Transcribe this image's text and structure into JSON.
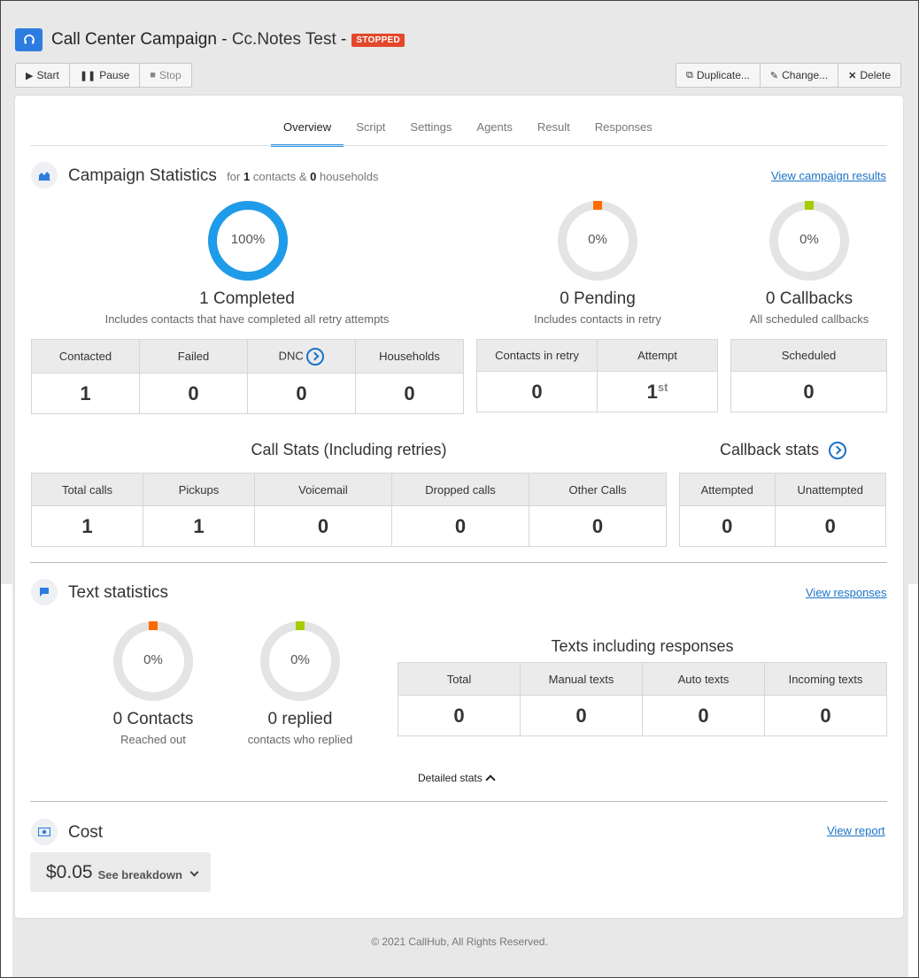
{
  "header": {
    "title": "Call Center Campaign",
    "separator": " - ",
    "subtitle": "Cc.Notes Test",
    "separator2": " - ",
    "status_badge": "STOPPED"
  },
  "toolbar": {
    "start_label": "Start",
    "pause_label": "Pause",
    "stop_label": "Stop",
    "duplicate_label": "Duplicate...",
    "change_label": "Change...",
    "delete_label": "Delete"
  },
  "tabs": [
    {
      "label": "Overview",
      "active": true
    },
    {
      "label": "Script"
    },
    {
      "label": "Settings"
    },
    {
      "label": "Agents"
    },
    {
      "label": "Result"
    },
    {
      "label": "Responses"
    }
  ],
  "campaign_stats": {
    "title": "Campaign Statistics",
    "meta_for": "for",
    "contacts_count": "1",
    "meta_contacts": "contacts &",
    "households_count": "0",
    "meta_households": "households",
    "view_link": "View campaign results",
    "completed": {
      "percent_text": "100%",
      "percent": 100,
      "label": "1 Completed",
      "desc": "Includes contacts that have completed all retry attempts",
      "color": "#1e9be9"
    },
    "pending": {
      "percent_text": "0%",
      "percent": 0,
      "label": "0 Pending",
      "desc": "Includes contacts in retry",
      "marker_color": "#ff6a00"
    },
    "callbacks": {
      "percent_text": "0%",
      "percent": 0,
      "label": "0 Callbacks",
      "desc": "All scheduled callbacks",
      "marker_color": "#a6cc00"
    },
    "contact_table": {
      "headers": [
        "Contacted",
        "Failed",
        "DNC",
        "Households"
      ],
      "values": [
        "1",
        "0",
        "0",
        "0"
      ]
    },
    "retry_table": {
      "headers": [
        "Contacts in retry",
        "Attempt"
      ],
      "values": [
        "0",
        "1"
      ],
      "attempt_suffix": "st"
    },
    "scheduled_table": {
      "headers": [
        "Scheduled"
      ],
      "values": [
        "0"
      ]
    }
  },
  "call_stats": {
    "title": "Call Stats (Including retries)",
    "headers": [
      "Total calls",
      "Pickups",
      "Voicemail",
      "Dropped calls",
      "Other Calls"
    ],
    "values": [
      "1",
      "1",
      "0",
      "0",
      "0"
    ]
  },
  "callback_stats": {
    "title": "Callback stats",
    "headers": [
      "Attempted",
      "Unattempted"
    ],
    "values": [
      "0",
      "0"
    ]
  },
  "text_stats": {
    "title": "Text statistics",
    "view_link": "View responses",
    "contacts": {
      "percent_text": "0%",
      "percent": 0,
      "label": "0 Contacts",
      "desc": "Reached out",
      "marker_color": "#ff6a00"
    },
    "replied": {
      "percent_text": "0%",
      "percent": 0,
      "label": "0 replied",
      "desc": "contacts who replied",
      "marker_color": "#a6cc00"
    },
    "texts_title": "Texts including responses",
    "headers": [
      "Total",
      "Manual texts",
      "Auto texts",
      "Incoming texts"
    ],
    "values": [
      "0",
      "0",
      "0",
      "0"
    ],
    "detailed_label": "Detailed stats"
  },
  "cost": {
    "title": "Cost",
    "view_link": "View report",
    "value": "$0.05",
    "breakdown_label": "See breakdown"
  },
  "footer": {
    "copyright": "© 2021 CallHub, All Rights Reserved."
  },
  "colors": {
    "accent": "#2d7de0",
    "link": "#1a73c7",
    "badge": "#e3482a",
    "ring_bg": "#e4e4e4"
  }
}
